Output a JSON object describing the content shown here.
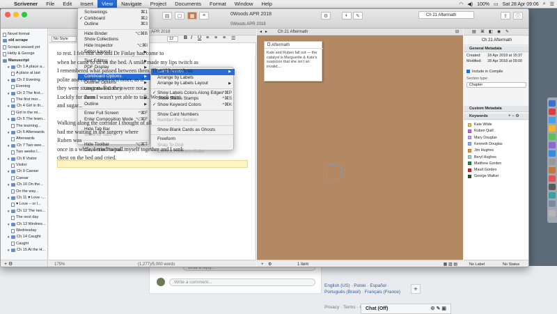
{
  "menubar": {
    "app": "Scrivener",
    "items": [
      "File",
      "Edit",
      "Insert",
      "View",
      "Navigate",
      "Project",
      "Documents",
      "Format",
      "Window",
      "Help"
    ],
    "active": "View",
    "status": {
      "battery": "100%",
      "clock": "Sat 28 Apr 09:06"
    }
  },
  "window": {
    "title": "0Woods APR 2018",
    "subtitle": "0Woods APR 2018",
    "format_style": "No Style",
    "format_size": "12",
    "cork_title": "Ch 21 Aftermath",
    "search_value": "Ch 21 Aftermath"
  },
  "binder": {
    "items": [
      {
        "label": "Novel format",
        "level": 0,
        "kind": "doc"
      },
      {
        "label": "old scrape",
        "level": 0,
        "kind": "folder"
      },
      {
        "label": "Scraps unused yet",
        "level": 0,
        "kind": "doc"
      },
      {
        "label": "Hetty & George",
        "level": 0,
        "kind": "doc"
      },
      {
        "label": "Manuscript",
        "level": 0,
        "kind": "folder"
      },
      {
        "label": "Ch 1 A place a...",
        "level": 1,
        "kind": "folder"
      },
      {
        "label": "A place at last",
        "level": 2,
        "kind": "doc"
      },
      {
        "label": "Ch 2 Evening",
        "level": 1,
        "kind": "folder"
      },
      {
        "label": "Evening",
        "level": 2,
        "kind": "doc"
      },
      {
        "label": "Ch 3 The first...",
        "level": 1,
        "kind": "folder"
      },
      {
        "label": "The first mor...",
        "level": 2,
        "kind": "doc"
      },
      {
        "label": "Ch 4 Girl in th...",
        "level": 1,
        "kind": "folder"
      },
      {
        "label": "Girl in the mi...",
        "level": 2,
        "kind": "doc"
      },
      {
        "label": "Ch 5 The learn...",
        "level": 1,
        "kind": "folder"
      },
      {
        "label": "The learning...",
        "level": 2,
        "kind": "doc"
      },
      {
        "label": "Ch 6 Afterwards",
        "level": 1,
        "kind": "folder"
      },
      {
        "label": "Afterwards",
        "level": 2,
        "kind": "doc"
      },
      {
        "label": "Ch 7 Two wee...",
        "level": 1,
        "kind": "folder"
      },
      {
        "label": "Two weeks l...",
        "level": 2,
        "kind": "doc"
      },
      {
        "label": "Ch 8 Visitor",
        "level": 1,
        "kind": "folder"
      },
      {
        "label": "Visitor",
        "level": 2,
        "kind": "doc"
      },
      {
        "label": "Ch 9 Caesar",
        "level": 1,
        "kind": "folder"
      },
      {
        "label": "Caesar",
        "level": 2,
        "kind": "doc"
      },
      {
        "label": "Ch 10 On the...",
        "level": 1,
        "kind": "folder"
      },
      {
        "label": "On the way...",
        "level": 2,
        "kind": "doc"
      },
      {
        "label": "Ch 11 ♥ Love -...",
        "level": 1,
        "kind": "folder"
      },
      {
        "label": "♥ Love – or l...",
        "level": 2,
        "kind": "doc"
      },
      {
        "label": "Ch 12 The nex...",
        "level": 1,
        "kind": "folder"
      },
      {
        "label": "The next day",
        "level": 2,
        "kind": "doc"
      },
      {
        "label": "Ch 13 Wednes...",
        "level": 1,
        "kind": "folder"
      },
      {
        "label": "Wednesday",
        "level": 2,
        "kind": "doc"
      },
      {
        "label": "Ch 14 Caught",
        "level": 1,
        "kind": "folder"
      },
      {
        "label": "Caught",
        "level": 2,
        "kind": "doc"
      },
      {
        "label": "Ch 15 At the H...",
        "level": 1,
        "kind": "folder"
      }
    ]
  },
  "editor": {
    "lines": [
      "to rest. I felt that she and Dr Finlay had come to",
      "when he came to sit on the bed. A smile made my lips twitch as",
      "I remembered what passed between them. They'd been oh-so",
      "polite and careful with each other, as if",
      "they were strangers. But they were not.",
      "Luckily for them I wasn't yet able to talk. We took mint",
      "and sugar... ",
      "",
      "Walking along the corridor I thought of all",
      "had me waiting in the surgery where",
      "Ruben was",
      "once in a while, I tried to pull myself together and I sank",
      "chest on the bed and cried."
    ],
    "zoom": "175%",
    "word_count": "(1,277)/5,000 words"
  },
  "card": {
    "title": "Aftermath",
    "text": "Kate and Ruben fall out — the catalyst is Marguerite & Kate's suspicion that she isn't an invalid...."
  },
  "cork_footer": {
    "count": "1 item"
  },
  "view_menu": {
    "items": [
      {
        "label": "Scrivenings",
        "shortcut": "⌘1",
        "checked": false
      },
      {
        "label": "Corkboard",
        "shortcut": "⌘2",
        "checked": true
      },
      {
        "label": "Outline",
        "shortcut": "⌘3",
        "checked": false
      },
      {
        "sep": true
      },
      {
        "label": "Hide Binder",
        "shortcut": "⌥⌘B"
      },
      {
        "label": "Show Collections",
        "shortcut": ""
      },
      {
        "label": "Hide Inspector",
        "shortcut": "⌥⌘I"
      },
      {
        "label": "Editor Layout",
        "shortcut": "",
        "submenu": true
      },
      {
        "sep": true
      },
      {
        "label": "Text Editing",
        "submenu": true
      },
      {
        "label": "PDF Display",
        "submenu": true
      },
      {
        "sep": true
      },
      {
        "label": "Corkboard Options",
        "submenu": true,
        "highlight": true
      },
      {
        "label": "Outliner Options",
        "submenu": true
      },
      {
        "label": "Use Labels Color In",
        "submenu": true
      },
      {
        "sep": true
      },
      {
        "label": "Zoom",
        "submenu": true
      },
      {
        "label": "Outline",
        "submenu": true
      },
      {
        "sep": true
      },
      {
        "label": "Enter Full Screen",
        "shortcut": "^⌘F"
      },
      {
        "label": "Enter Composition Mode",
        "shortcut": "⌥⌘F"
      },
      {
        "sep": true
      },
      {
        "label": "Hide Tab Bar"
      },
      {
        "label": "Show All Tabs",
        "disabled": true
      },
      {
        "sep": true
      },
      {
        "label": "Hide Toolbar",
        "shortcut": "⌥⌘T"
      },
      {
        "label": "Customize Toolbar..."
      }
    ]
  },
  "cork_submenu": {
    "items": [
      {
        "label": "Cards Across",
        "submenu": true,
        "highlight": true
      },
      {
        "label": "Arrange by Labels"
      },
      {
        "label": "Arrange by Labels Layout",
        "submenu": true
      },
      {
        "sep": true
      },
      {
        "label": "Show Labels Colors Along Edges",
        "shortcut": "^⌘P",
        "checked": true
      },
      {
        "label": "Show Status Stamps",
        "shortcut": "^⌘S"
      },
      {
        "label": "Show Keyword Colors",
        "shortcut": "^⌘K",
        "checked": true
      },
      {
        "sep": true
      },
      {
        "label": "Show Card Numbers"
      },
      {
        "label": "Number Per Section",
        "disabled": true
      },
      {
        "sep": true
      },
      {
        "label": "Show Blank Cards as Ghosts"
      },
      {
        "sep": true
      },
      {
        "label": "Freeform"
      },
      {
        "label": "Snap To Grid",
        "disabled": true
      },
      {
        "label": "Commit Freeform Order",
        "disabled": true
      }
    ]
  },
  "inspector": {
    "header": "Ch 21 Aftermath",
    "general_title": "General Metadata",
    "created_label": "Created:",
    "created_value": "18 Apr 2018 at 15:37",
    "modified_label": "Modified:",
    "modified_value": "28 Apr 2018 at 09:00",
    "include_compile": "Include in Compile",
    "section_type_label": "Section type:",
    "section_type_value": "Chapter",
    "custom_title": "Custom Metadata",
    "keywords_title": "Keywords",
    "keywords": [
      {
        "name": "Kate Wilde",
        "color": "#e8c84a"
      },
      {
        "name": "Ruben Quill",
        "color": "#c070d0"
      },
      {
        "name": "Mary Douglas",
        "color": "#c8a8e8"
      },
      {
        "name": "Kenneth Douglas",
        "color": "#9ab0ff"
      },
      {
        "name": "Jim Hughes",
        "color": "#f09a38"
      },
      {
        "name": "Beryl Hughes",
        "color": "#a6d7c9"
      },
      {
        "name": "Matthew Gorden",
        "color": "#2c8a3c"
      },
      {
        "name": "Maud Gorden",
        "color": "#d22a2a"
      },
      {
        "name": "George Walker",
        "color": "#2f5f2f"
      }
    ],
    "footer_label": "No Label",
    "footer_status": "No Status"
  },
  "webpage": {
    "reply_placeholder": "Write a reply...",
    "comment_placeholder": "Write a comment...",
    "lang_line1": "English (US) · Polski · Español ·",
    "lang_line2": "Português (Brasil) · Français (France)",
    "privacy": "Privacy · Terms · Cookies · More",
    "chat": "Chat (Off)"
  }
}
